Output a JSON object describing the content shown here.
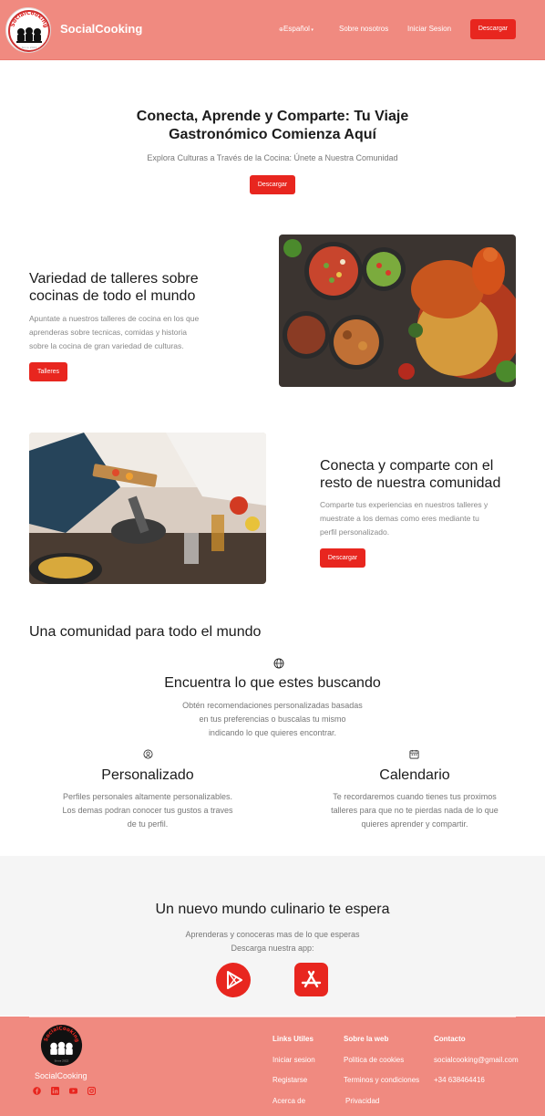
{
  "header": {
    "brand": "SocialCooking",
    "logo_text": "SocialCooking",
    "logo_sub": "Since 2022",
    "language": "Español",
    "nav_about": "Sobre nosotros",
    "nav_login": "Iniciar Sesion",
    "download": "Descargar"
  },
  "hero": {
    "title_line1": "Conecta, Aprende y Comparte: Tu Viaje",
    "title_line2": "Gastronómico Comienza Aquí",
    "subtitle": "Explora Culturas a Través de la Cocina: Únete a Nuestra Comunidad",
    "button": "Descargar"
  },
  "workshops": {
    "title_line1": "Variedad de talleres sobre",
    "title_line2": "cocinas de todo el mundo",
    "text_line1": "Apuntate a nuestros talleres de cocina en los que",
    "text_line2": "aprenderas sobre tecnicas, comidas y historia",
    "text_line3": "sobre la cocina de gran variedad de culturas.",
    "button": "Talleres"
  },
  "community": {
    "title_line1": "Conecta y comparte con el",
    "title_line2": "resto de nuestra comunidad",
    "text_line1": "Comparte tus experiencias en nuestros talleres y",
    "text_line2": "muestrate a los demas como eres mediante tu",
    "text_line3": "perfil personalizado.",
    "button": "Descargar"
  },
  "features": {
    "heading": "Una comunidad para todo el mundo",
    "items": [
      {
        "icon": "globe-icon",
        "title": "Encuentra lo que estes buscando",
        "line1": "Obtén recomendaciones personalizadas basadas",
        "line2": "en tus preferencias o buscalas tu mismo",
        "line3": "indicando lo que quieres encontrar."
      },
      {
        "icon": "user-circle-icon",
        "title": "Personalizado",
        "line1": "Perfiles personales altamente personalizables.",
        "line2": "Los demas podran conocer tus gustos a traves",
        "line3": "de tu perfil."
      },
      {
        "icon": "calendar-icon",
        "title": "Calendario",
        "line1": "Te recordaremos cuando tienes tus proximos",
        "line2": "talleres para que no te pierdas nada de lo que",
        "line3": "quieres aprender y compartir."
      }
    ]
  },
  "download_band": {
    "title": "Un nuevo mundo culinario te espera",
    "line1": "Aprenderas y conoceras mas de lo que esperas",
    "line2": "Descarga nuestra app:",
    "apps": [
      "google-play-icon",
      "app-store-icon"
    ]
  },
  "footer": {
    "brand": "SocialCooking",
    "social": [
      "facebook-icon",
      "linkedin-icon",
      "youtube-icon",
      "instagram-icon"
    ],
    "col1": {
      "heading": "Links Utiles",
      "items": [
        "Iniciar sesion",
        "Registarse",
        "Acerca de"
      ]
    },
    "col2": {
      "heading": "Sobre la web",
      "items": [
        "Politica de cookies",
        "Terminos y condiciones",
        "Privacidad"
      ]
    },
    "col3": {
      "heading": "Contacto",
      "items": [
        "socialcooking@gmail.com",
        "+34 638464416"
      ]
    }
  },
  "colors": {
    "accent": "#e8261f",
    "header_bg": "#f08a80",
    "band_bg": "#f5f5f5"
  }
}
